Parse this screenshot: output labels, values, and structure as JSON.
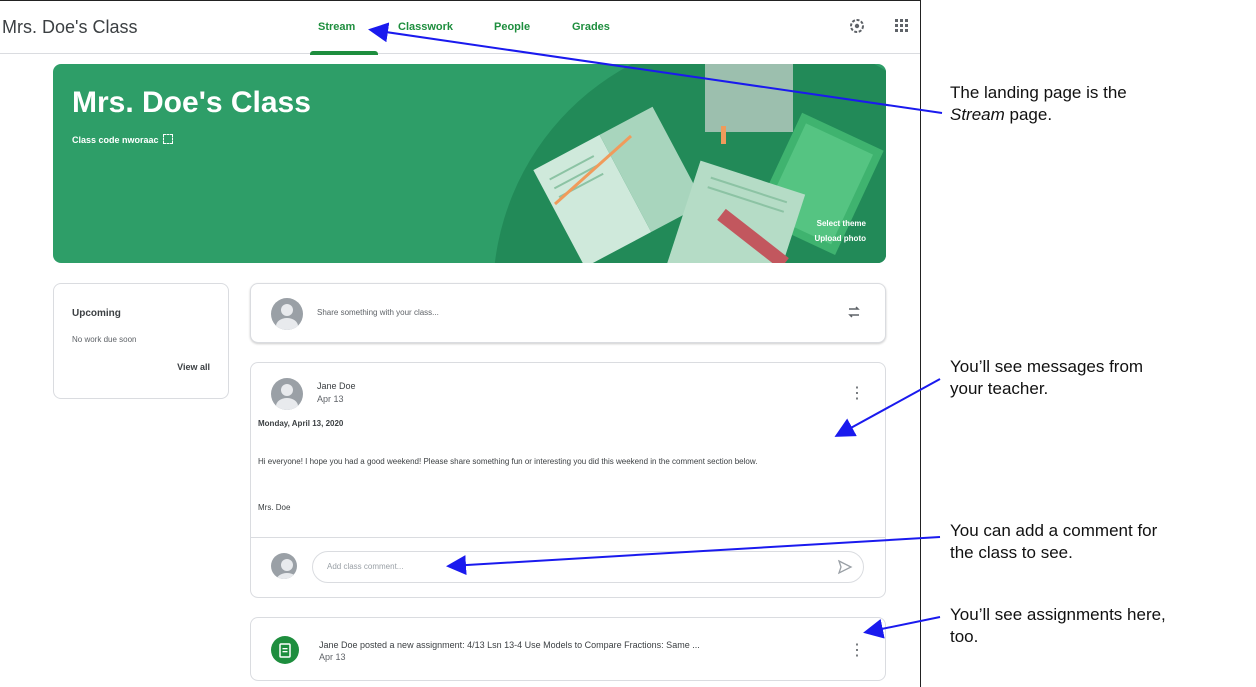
{
  "app": {
    "title": "Mrs. Doe's Class"
  },
  "tabs": [
    {
      "label": "Stream"
    },
    {
      "label": "Classwork"
    },
    {
      "label": "People"
    },
    {
      "label": "Grades"
    }
  ],
  "icons": {
    "settings": "gear-icon",
    "apps": "grid-icon"
  },
  "banner": {
    "title": "Mrs. Doe's Class",
    "class_code_label": "Class code",
    "class_code": "nworaac",
    "select_theme": "Select theme",
    "upload_photo": "Upload photo"
  },
  "upcoming": {
    "title": "Upcoming",
    "subtitle": "No work due soon",
    "view_all": "View all"
  },
  "share": {
    "placeholder": "Share something with your class..."
  },
  "post": {
    "author": "Jane Doe",
    "date": "Apr 13",
    "heading": "Monday, April 13, 2020",
    "body": "Hi everyone! I hope you had a good weekend! Please share something fun or interesting you did this weekend in the comment section below.",
    "signature": "Mrs. Doe",
    "comment_placeholder": "Add class comment..."
  },
  "assignment": {
    "text": "Jane Doe posted a new assignment: 4/13 Lsn 13-4 Use Models to Compare Fractions: Same ...",
    "date": "Apr 13"
  },
  "annotations": {
    "stream_line1": "The landing page is the",
    "stream_em": "Stream",
    "stream_rest": " page.",
    "messages_line1": "You’ll see messages from",
    "messages_line2": "your teacher.",
    "comment_line1": "You can add a comment for",
    "comment_line2": "the class to see.",
    "assignments_line1": "You’ll see assignments here,",
    "assignments_line2": "too."
  },
  "colors": {
    "accent": "#1e8e3e",
    "banner": "#2e9e68",
    "arrow": "#1a1aee"
  }
}
